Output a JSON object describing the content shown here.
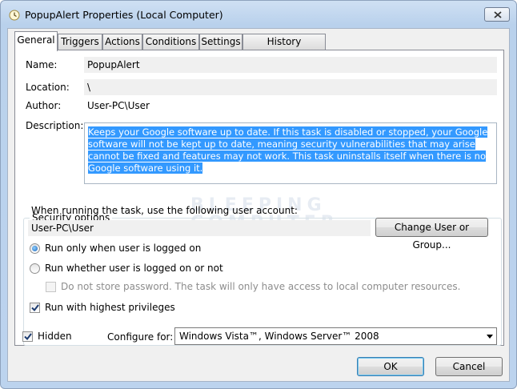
{
  "window": {
    "title": "PopupAlert Properties (Local Computer)"
  },
  "tabs": [
    {
      "label": "General",
      "active": true
    },
    {
      "label": "Triggers",
      "active": false
    },
    {
      "label": "Actions",
      "active": false
    },
    {
      "label": "Conditions",
      "active": false
    },
    {
      "label": "Settings",
      "active": false
    },
    {
      "label": "History (disabled)",
      "active": false
    }
  ],
  "general": {
    "name_label": "Name:",
    "name_value": "PopupAlert",
    "location_label": "Location:",
    "location_value": "\\",
    "author_label": "Author:",
    "author_value": "User-PC\\User",
    "description_label": "Description:",
    "description_value": "Keeps your Google software up to date. If this task is disabled or stopped, your Google software will not be kept up to date, meaning security vulnerabilities that may arise cannot be fixed and features may not work. This task uninstalls itself when there is no Google software using it."
  },
  "watermark": {
    "line1": "BLEEPING",
    "line2": "COMPUTER"
  },
  "security": {
    "group_title": "Security options",
    "account_prompt": "When running the task, use the following user account:",
    "account_value": "User-PC\\User",
    "change_button": "Change User or Group...",
    "radio_logged_on": "Run only when user is logged on",
    "radio_whether": "Run whether user is logged on or not",
    "no_store_password": "Do not store password.  The task will only have access to local computer resources.",
    "highest_privileges": "Run with highest privileges",
    "selected_radio": "logged_on",
    "highest_checked": true,
    "no_store_checked": false
  },
  "bottom": {
    "hidden_label": "Hidden",
    "hidden_checked": true,
    "configure_label": "Configure for:",
    "configure_value": "Windows Vista™, Windows Server™ 2008"
  },
  "buttons": {
    "ok": "OK",
    "cancel": "Cancel"
  },
  "colors": {
    "selection": "#3399ff",
    "title_bar": "#b9d1ec"
  }
}
